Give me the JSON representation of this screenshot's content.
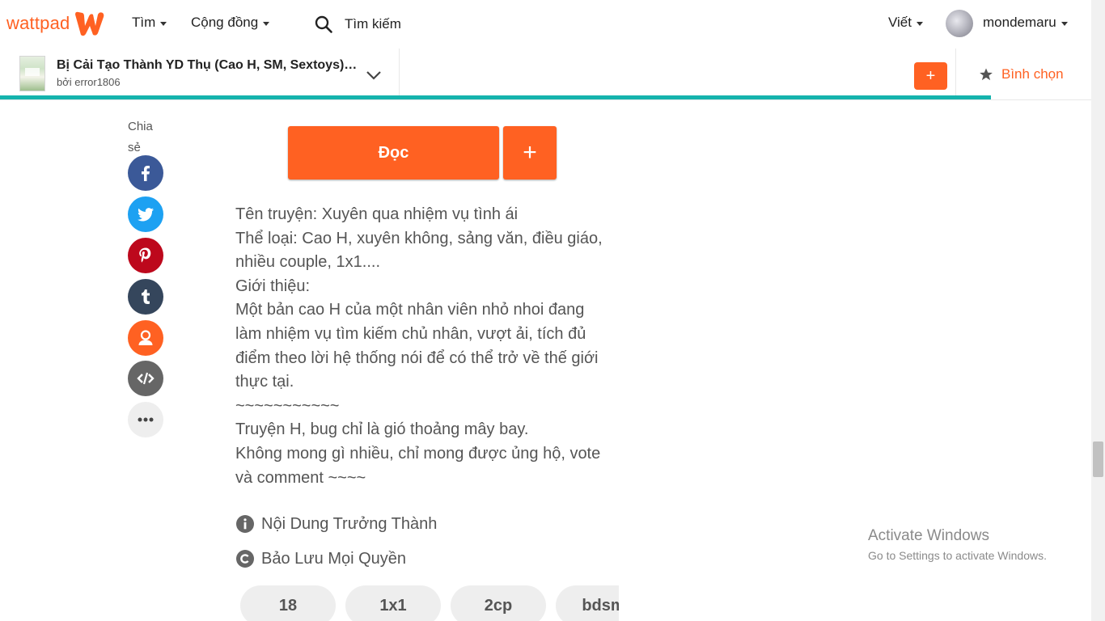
{
  "nav": {
    "logo_text": "wattpad",
    "discover": "Tìm",
    "community": "Cộng đồng",
    "search_label": "Tìm kiếm",
    "write": "Viết",
    "username": "mondemaru"
  },
  "story_bar": {
    "title": "Bị Cải Tạo Thành YD Thụ (Cao H, SM, Sextoys)_e...",
    "author": "bởi error1806",
    "add_label": "+",
    "vote_label": "Bình chọn",
    "progress_color": "#15b3ad"
  },
  "share": {
    "label": "Chia sẻ",
    "buttons": [
      {
        "name": "facebook-icon",
        "color": "#3b5998"
      },
      {
        "name": "twitter-icon",
        "color": "#1da1f2"
      },
      {
        "name": "pinterest-icon",
        "color": "#bd081c"
      },
      {
        "name": "tumblr-icon",
        "color": "#35465c"
      },
      {
        "name": "user-icon",
        "color": "#ff6122"
      },
      {
        "name": "embed-code-icon",
        "color": "#666666"
      },
      {
        "name": "more-icon",
        "color": "#eeeeee"
      }
    ]
  },
  "content": {
    "read_label": "Đọc",
    "plus_label": "+",
    "description": [
      "Tên truyện: Xuyên qua nhiệm vụ tình ái",
      "Thể loại: Cao H, xuyên không, sảng văn, điều giáo,",
      "nhiều couple,  1x1....",
      "Giới thiệu:",
      "Một bản cao H của một nhân viên nhỏ nhoi đang",
      "làm nhiệm vụ tìm kiếm chủ nhân, vượt ải, tích đủ",
      "điểm theo lời hệ thống nói để có thể trở về thế giới",
      "thực tại.",
      "~~~~~~~~~~~",
      "Truyện H, bug chỉ là gió thoảng mây bay.",
      "Không mong gì nhiều, chỉ mong được ủng hộ, vote",
      "và comment ~~~~"
    ],
    "mature_label": "Nội Dung Trưởng Thành",
    "copyright_label": "Bảo Lưu Mọi Quyền",
    "tags": [
      "18",
      "1x1",
      "2cp",
      "bdsm"
    ]
  },
  "windows": {
    "activate_title": "Activate Windows",
    "activate_sub": "Go to Settings to activate Windows."
  },
  "colors": {
    "brand": "#ff6122",
    "accent": "#15b3ad"
  }
}
